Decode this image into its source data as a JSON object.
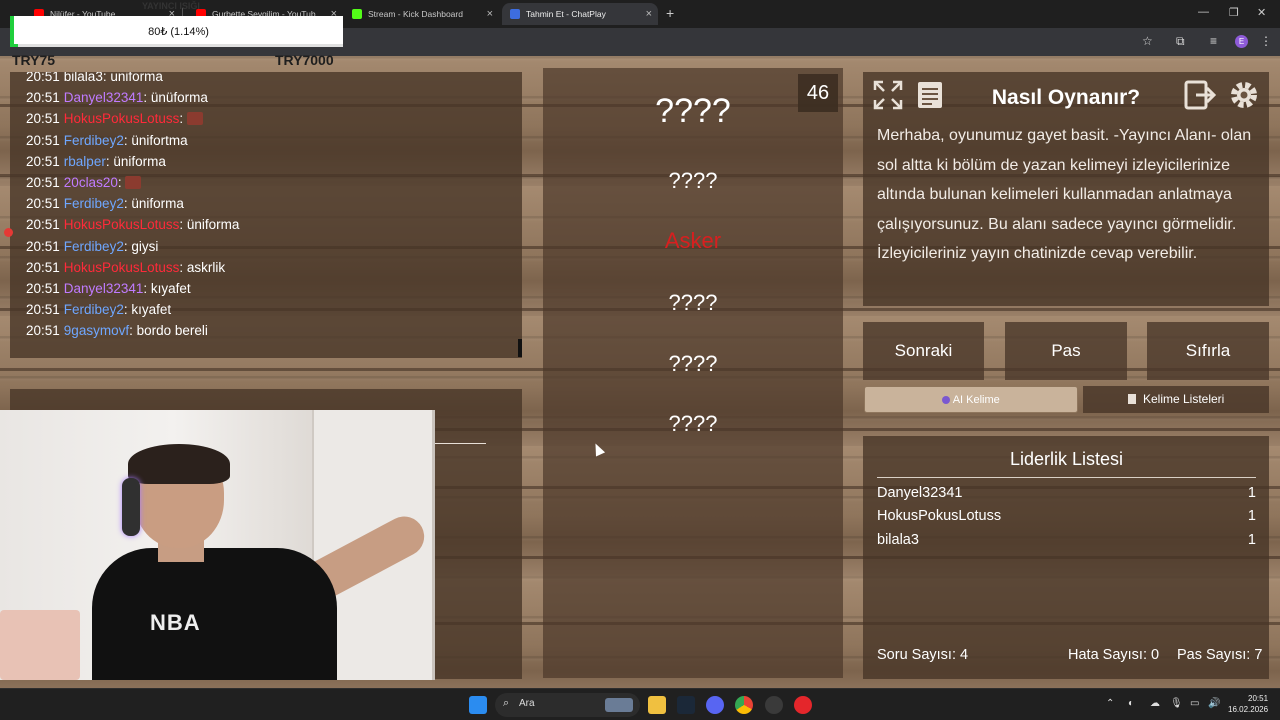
{
  "browser": {
    "tabs": [
      {
        "label": "Nilüfer - YouTube",
        "color": "#ff0000"
      },
      {
        "label": "Gurbette Sevgilim - YouTub",
        "color": "#ff0000"
      },
      {
        "label": "Stream - Kick Dashboard",
        "color": "#53fc18"
      },
      {
        "label": "Tahmin Et - ChatPlay",
        "color": "#3d6de0"
      }
    ],
    "overlay_text": "YAYINCI ISIĞI",
    "profile_initial": "E"
  },
  "overlay": {
    "progress_label": "80₺ (1.14%)",
    "progress_fraction": 0.0114,
    "try_left": "TRY75",
    "try_right": "TRY7000"
  },
  "chat": {
    "messages": [
      {
        "time": "20:51",
        "user": "bilala3",
        "color": "#ffffff",
        "text": "uniforma"
      },
      {
        "time": "20:51",
        "user": "Danyel32341",
        "color": "#c07bff",
        "text": "ünüforma"
      },
      {
        "time": "20:51",
        "user": "HokusPokusLotuss",
        "color": "#ff2a3a",
        "text": "",
        "emote": true
      },
      {
        "time": "20:51",
        "user": "Ferdibey2",
        "color": "#6fa7ff",
        "text": "ünifortma"
      },
      {
        "time": "20:51",
        "user": "rbalper",
        "color": "#6fa7ff",
        "text": "üniforma"
      },
      {
        "time": "20:51",
        "user": "20clas20",
        "color": "#c07bff",
        "text": "",
        "emote": true
      },
      {
        "time": "20:51",
        "user": "Ferdibey2",
        "color": "#6fa7ff",
        "text": "üniforma"
      },
      {
        "time": "20:51",
        "user": "HokusPokusLotuss",
        "color": "#ff2a3a",
        "text": "üniforma"
      },
      {
        "time": "20:51",
        "user": "Ferdibey2",
        "color": "#6fa7ff",
        "text": "giysi"
      },
      {
        "time": "20:51",
        "user": "HokusPokusLotuss",
        "color": "#ff2a3a",
        "text": "askrlik"
      },
      {
        "time": "20:51",
        "user": "Danyel32341",
        "color": "#c07bff",
        "text": "kıyafet"
      },
      {
        "time": "20:51",
        "user": "Ferdibey2",
        "color": "#6fa7ff",
        "text": "kıyafet"
      },
      {
        "time": "20:51",
        "user": "9gasymovf",
        "color": "#6fa7ff",
        "text": "bordo bereli"
      }
    ]
  },
  "game": {
    "timer": "46",
    "words": [
      {
        "text": "????",
        "size": 34
      },
      {
        "text": "????",
        "size": 22
      },
      {
        "text": "Asker",
        "size": 22,
        "target": true
      },
      {
        "text": "????",
        "size": 22
      },
      {
        "text": "????",
        "size": 22
      },
      {
        "text": "????",
        "size": 22
      }
    ]
  },
  "howto": {
    "title": "Nasıl Oynanır?",
    "text": "Merhaba, oyunumuz gayet basit. -Yayıncı Alanı- olan sol altta ki bölüm de yazan kelimeyi izleyicilerinize altında bulunan kelimeleri kullanmadan anlatmaya çalışıyorsunuz. Bu alanı sadece yayıncı görmelidir. İzleyicileriniz yayın chatinizde cevap verebilir."
  },
  "buttons": {
    "next": "Sonraki",
    "pass": "Pas",
    "reset": "Sıfırla",
    "ai_word": "AI Kelime",
    "word_lists": "Kelime Listeleri"
  },
  "leaderboard": {
    "title": "Liderlik Listesi",
    "rows": [
      {
        "name": "Danyel32341",
        "score": "1"
      },
      {
        "name": "HokusPokusLotuss",
        "score": "1"
      },
      {
        "name": "bilala3",
        "score": "1"
      }
    ]
  },
  "stats": {
    "questions": "Soru Sayısı: 4",
    "errors": "Hata Sayısı: 0",
    "passes": "Pas Sayısı: 7"
  },
  "webcam": {
    "shirt_logo": "NBA"
  },
  "taskbar": {
    "search_label": "Ara",
    "time": "20:51",
    "date": "16.02.2026"
  }
}
